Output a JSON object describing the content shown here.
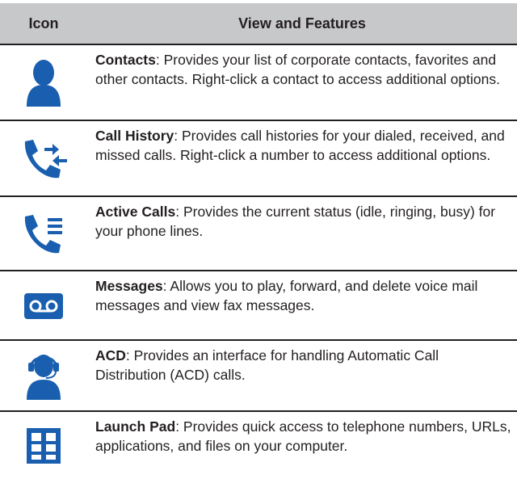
{
  "header": {
    "icon_col": "Icon",
    "view_col": "View and Features"
  },
  "colors": {
    "icon_blue": "#1a5faf",
    "header_bg": "#c7c8ca"
  },
  "rows": [
    {
      "icon": "contacts-icon",
      "title": "Contacts",
      "desc": ": Provides your list of corporate contacts, favorites and other contacts. Right-click a contact to access additional options."
    },
    {
      "icon": "call-history-icon",
      "title": "Call History",
      "desc": ": Provides call histories for your dialed, received, and missed calls. Right-click a number to access additional options."
    },
    {
      "icon": "active-calls-icon",
      "title": "Active Calls",
      "desc": ": Provides the current status (idle, ringing, busy) for your phone lines."
    },
    {
      "icon": "voicemail-icon",
      "title": "Messages",
      "desc": ": Allows you to play, forward, and delete voice mail messages and view fax messages."
    },
    {
      "icon": "headset-agent-icon",
      "title": "ACD",
      "desc": ": Provides an interface for handling Automatic Call Distribution (ACD) calls."
    },
    {
      "icon": "launch-pad-grid-icon",
      "title": "Launch Pad",
      "desc": ": Provides quick access to telephone numbers, URLs, applications, and files on your computer."
    }
  ]
}
